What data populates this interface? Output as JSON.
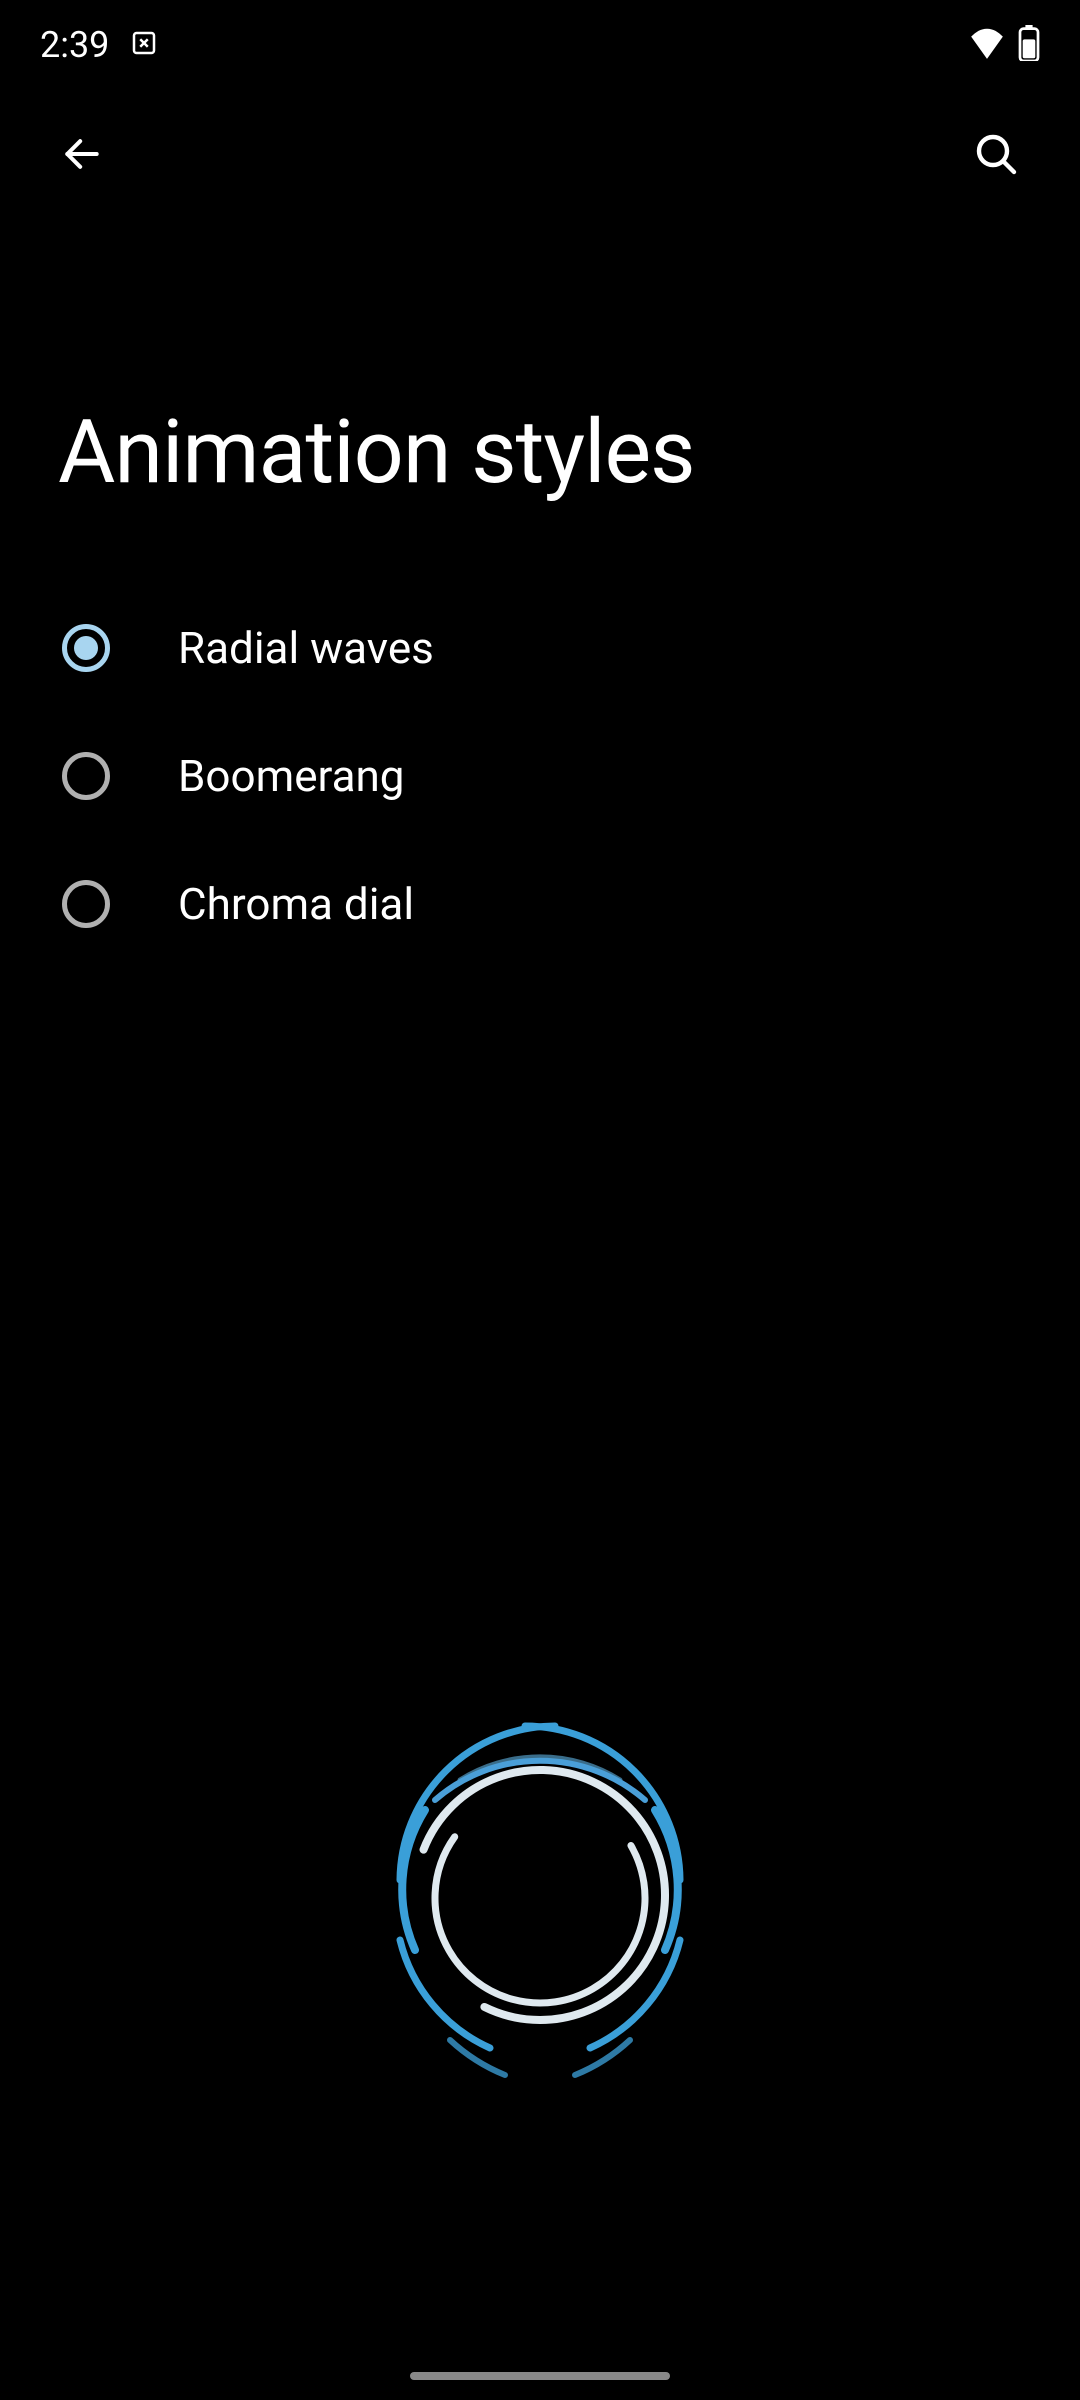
{
  "status_bar": {
    "time": "2:39",
    "icons": {
      "left_extra": "close-box-icon",
      "wifi": "wifi-icon",
      "battery": "battery-icon"
    }
  },
  "app_bar": {
    "back": "arrow-back-icon",
    "search": "search-icon"
  },
  "title": "Animation styles",
  "options": [
    {
      "label": "Radial waves",
      "selected": true
    },
    {
      "label": "Boomerang",
      "selected": false
    },
    {
      "label": "Chroma dial",
      "selected": false
    }
  ],
  "preview": {
    "style": "radial-waves",
    "accent_color": "#3a9fd8",
    "secondary_color": "#dfe9ef"
  }
}
